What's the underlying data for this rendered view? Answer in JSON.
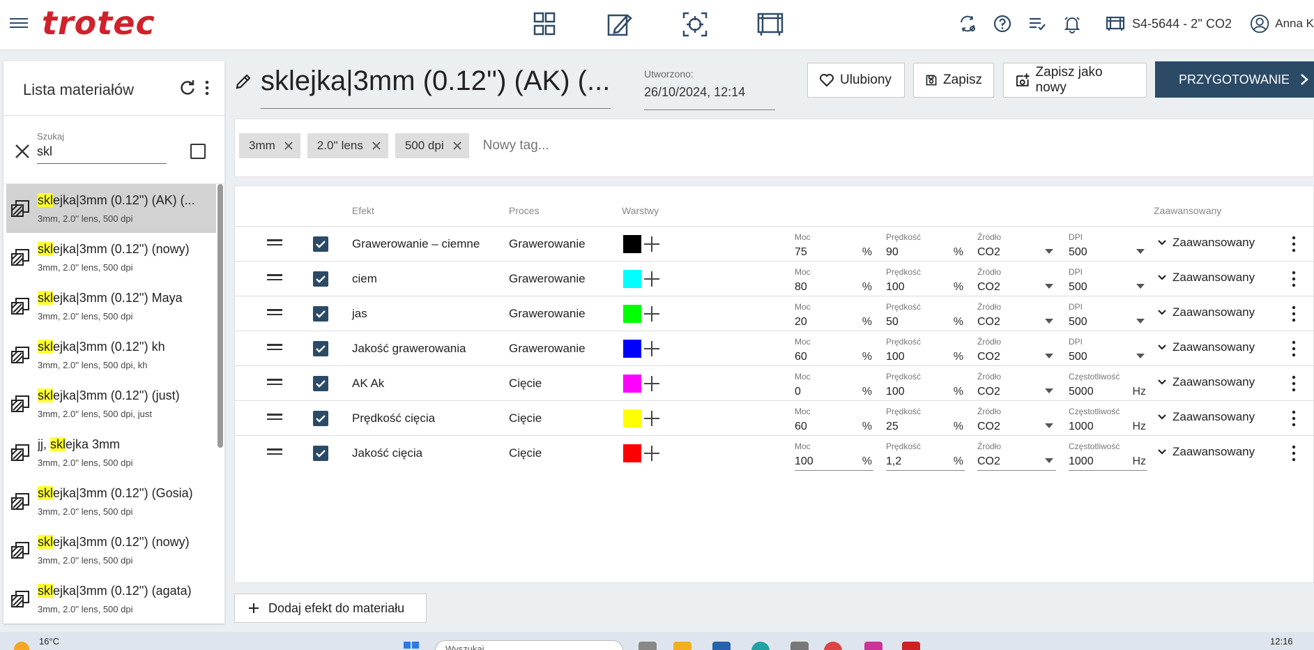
{
  "header": {
    "logo": "trotec",
    "machine": "S4-5644 - 2'' CO2",
    "user": "Anna K"
  },
  "sidebar": {
    "title": "Lista materiałów",
    "search": {
      "label": "Szukaj",
      "value": "skl"
    },
    "items": [
      {
        "hl": "skl",
        "rest": "ejka|3mm (0.12'') (AK) (...",
        "tags": "3mm, 2.0'' lens, 500 dpi",
        "selected": true
      },
      {
        "hl": "skl",
        "rest": "ejka|3mm (0.12'') (nowy)",
        "tags": "3mm, 2.0'' lens, 500 dpi"
      },
      {
        "hl": "skl",
        "rest": "ejka|3mm (0.12'') Maya",
        "tags": "3mm, 2.0'' lens, 500 dpi"
      },
      {
        "hl": "skl",
        "rest": "ejka|3mm (0.12'') kh",
        "tags": "3mm, 2.0'' lens, 500 dpi, kh"
      },
      {
        "hl": "skl",
        "rest": "ejka|3mm (0.12'') (just)",
        "tags": "3mm, 2.0'' lens, 500 dpi, just"
      },
      {
        "pre": "jj, ",
        "hl": "skl",
        "rest": "ejka 3mm",
        "tags": "3mm, 2.0'' lens, 500 dpi"
      },
      {
        "hl": "skl",
        "rest": "ejka|3mm (0.12'') (Gosia)",
        "tags": "3mm, 2.0'' lens, 500 dpi"
      },
      {
        "hl": "skl",
        "rest": "ejka|3mm (0.12'') (nowy)",
        "tags": "3mm, 2.0'' lens, 500 dpi"
      },
      {
        "hl": "skl",
        "rest": "ejka|3mm (0.12'') (agata)",
        "tags": "3mm, 2.0'' lens, 500 dpi"
      }
    ]
  },
  "material": {
    "title": "sklejka|3mm (0.12'') (AK) (...",
    "created_label": "Utworzono:",
    "created_value": "26/10/2024, 12:14"
  },
  "buttons": {
    "favorite": "Ulubiony",
    "save": "Zapisz",
    "save_as_new": "Zapisz jako nowy",
    "prepare": "PRZYGOTOWANIE",
    "add_effect": "Dodaj efekt do materiału"
  },
  "tags": {
    "items": [
      "3mm",
      "2.0'' lens",
      "500 dpi"
    ],
    "placeholder": "Nowy tag..."
  },
  "table": {
    "headers": {
      "effect": "Efekt",
      "process": "Proces",
      "layers": "Warstwy",
      "advanced": "Zaawansowany"
    },
    "rows": [
      {
        "effect": "Grawerowanie – ciemne",
        "process": "Grawerowanie",
        "color": "#000000",
        "moc_label": "Moc",
        "moc": "75",
        "moc_unit": "%",
        "speed_label": "Prędkość",
        "speed": "90",
        "speed_unit": "%",
        "source_label": "Źródło",
        "source": "CO2",
        "last_label": "DPI",
        "last": "500",
        "last_unit": "",
        "advanced": "Zaawansowany"
      },
      {
        "effect": "ciem",
        "process": "Grawerowanie",
        "color": "#00ffff",
        "moc_label": "Moc",
        "moc": "80",
        "moc_unit": "%",
        "speed_label": "Prędkość",
        "speed": "100",
        "speed_unit": "%",
        "source_label": "Źródło",
        "source": "CO2",
        "last_label": "DPI",
        "last": "500",
        "last_unit": "",
        "advanced": "Zaawansowany"
      },
      {
        "effect": "jas",
        "process": "Grawerowanie",
        "color": "#00ff00",
        "moc_label": "Moc",
        "moc": "20",
        "moc_unit": "%",
        "speed_label": "Prędkość",
        "speed": "50",
        "speed_unit": "%",
        "source_label": "Źródło",
        "source": "CO2",
        "last_label": "DPI",
        "last": "500",
        "last_unit": "",
        "advanced": "Zaawansowany"
      },
      {
        "effect": "Jakość grawerowania",
        "process": "Grawerowanie",
        "color": "#0000ff",
        "moc_label": "Moc",
        "moc": "60",
        "moc_unit": "%",
        "speed_label": "Prędkość",
        "speed": "100",
        "speed_unit": "%",
        "source_label": "Źródło",
        "source": "CO2",
        "last_label": "DPI",
        "last": "500",
        "last_unit": "",
        "advanced": "Zaawansowany"
      },
      {
        "effect": "AK Ak",
        "process": "Cięcie",
        "color": "#ff00ff",
        "moc_label": "Moc",
        "moc": "0",
        "moc_unit": "%",
        "speed_label": "Prędkość",
        "speed": "100",
        "speed_unit": "%",
        "source_label": "Źródło",
        "source": "CO2",
        "last_label": "Częstotliwość",
        "last": "5000",
        "last_unit": "Hz",
        "advanced": "Zaawansowany"
      },
      {
        "effect": "Prędkość cięcia",
        "process": "Cięcie",
        "color": "#ffff00",
        "moc_label": "Moc",
        "moc": "60",
        "moc_unit": "%",
        "speed_label": "Prędkość",
        "speed": "25",
        "speed_unit": "%",
        "source_label": "Źródło",
        "source": "CO2",
        "last_label": "Częstotliwość",
        "last": "1000",
        "last_unit": "Hz",
        "advanced": "Zaawansowany"
      },
      {
        "effect": "Jakość cięcia",
        "process": "Cięcie",
        "color": "#ff0000",
        "moc_label": "Moc",
        "moc": "100",
        "moc_unit": "%",
        "speed_label": "Prędkość",
        "speed": "1,2",
        "speed_unit": "%",
        "source_label": "Źródło",
        "source": "CO2",
        "last_label": "Częstotliwość",
        "last": "1000",
        "last_unit": "Hz",
        "advanced": "Zaawansowany"
      }
    ]
  },
  "taskbar": {
    "temperature": "16°C",
    "search_placeholder": "Wyszukaj",
    "time": "12:16"
  },
  "colors": {
    "brand": "#d0222c",
    "primary": "#2b4a66",
    "highlight": "#ffff33"
  }
}
